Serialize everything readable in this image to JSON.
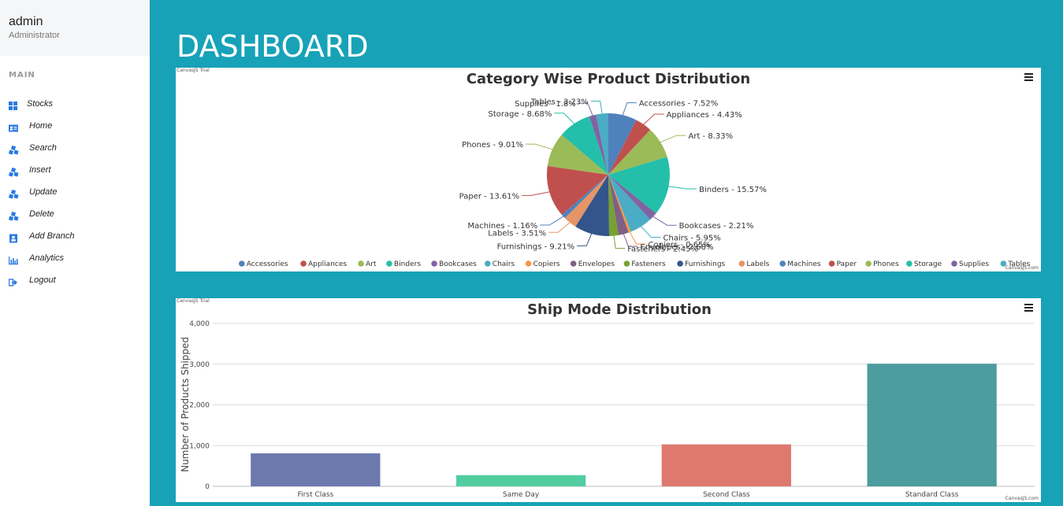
{
  "user": {
    "name": "admin",
    "role": "Administrator"
  },
  "sidebar": {
    "section_label": "MAIN",
    "items": [
      {
        "label": "Stocks",
        "icon": "grid-icon"
      },
      {
        "label": "Home",
        "icon": "id-card-icon"
      },
      {
        "label": "Search",
        "icon": "cubes-icon"
      },
      {
        "label": "Insert",
        "icon": "cubes-icon"
      },
      {
        "label": "Update",
        "icon": "cubes-icon"
      },
      {
        "label": "Delete",
        "icon": "cubes-icon"
      },
      {
        "label": "Add Branch",
        "icon": "user-square-icon"
      },
      {
        "label": "Analytics",
        "icon": "bar-chart-icon"
      },
      {
        "label": "Logout",
        "icon": "sign-out-icon"
      }
    ]
  },
  "page": {
    "title": "DASHBOARD"
  },
  "accent_color": "#17a2b8",
  "watermark": {
    "trial": "CanvasJS Trial",
    "credit": "CanvasJS.com"
  },
  "chart_data": [
    {
      "type": "pie",
      "title": "Category Wise Product Distribution",
      "legend_position": "bottom",
      "slices": [
        {
          "label": "Accessories",
          "value": 7.52,
          "display": "Accessories - 7.52%",
          "color": "#4f81bc"
        },
        {
          "label": "Appliances",
          "value": 4.43,
          "display": "Appliances - 4.43%",
          "color": "#c0504e"
        },
        {
          "label": "Art",
          "value": 8.33,
          "display": "Art - 8.33%",
          "color": "#9bbb58"
        },
        {
          "label": "Binders",
          "value": 15.57,
          "display": "Binders - 15.57%",
          "color": "#23bfaa"
        },
        {
          "label": "Bookcases",
          "value": 2.21,
          "display": "Bookcases - 2.21%",
          "color": "#8064a1"
        },
        {
          "label": "Chairs",
          "value": 5.95,
          "display": "Chairs - 5.95%",
          "color": "#4aacc5"
        },
        {
          "label": "Copiers",
          "value": 0.65,
          "display": "Copiers - 0.65%",
          "color": "#f79647"
        },
        {
          "label": "Envelopes",
          "value": 2.68,
          "display": "Envelopes - 2.68%",
          "color": "#7f6084"
        },
        {
          "label": "Fasteners",
          "value": 2.45,
          "display": "Fasteners - 2.45%",
          "color": "#77a033"
        },
        {
          "label": "Furnishings",
          "value": 9.21,
          "display": "Furnishings - 9.21%",
          "color": "#33558b"
        },
        {
          "label": "Labels",
          "value": 3.51,
          "display": "Labels - 3.51%",
          "color": "#e59566"
        },
        {
          "label": "Machines",
          "value": 1.16,
          "display": "Machines - 1.16%",
          "color": "#4f81bc"
        },
        {
          "label": "Paper",
          "value": 13.61,
          "display": "Paper - 13.61%",
          "color": "#c0504e"
        },
        {
          "label": "Phones",
          "value": 9.01,
          "display": "Phones - 9.01%",
          "color": "#9bbb58"
        },
        {
          "label": "Storage",
          "value": 8.68,
          "display": "Storage - 8.68%",
          "color": "#23bfaa"
        },
        {
          "label": "Supplies",
          "value": 1.8,
          "display": "Supplies - 1.8%",
          "color": "#8064a1"
        },
        {
          "label": "Tables",
          "value": 3.23,
          "display": "Tables - 3.23%",
          "color": "#4aacc5"
        }
      ]
    },
    {
      "type": "bar",
      "title": "Ship Mode Distribution",
      "ylabel": "Number of Products Shipped",
      "xlabel": "",
      "ylim": [
        0,
        4000
      ],
      "yticks": [
        "0",
        "1,000",
        "2,000",
        "3,000",
        "4,000"
      ],
      "grid": true,
      "categories": [
        "First Class",
        "Same Day",
        "Second Class",
        "Standard Class"
      ],
      "values": [
        810,
        275,
        1030,
        3010
      ],
      "colors": [
        "#6d78ad",
        "#51cda0",
        "#df7970",
        "#4c9ca0"
      ]
    }
  ]
}
